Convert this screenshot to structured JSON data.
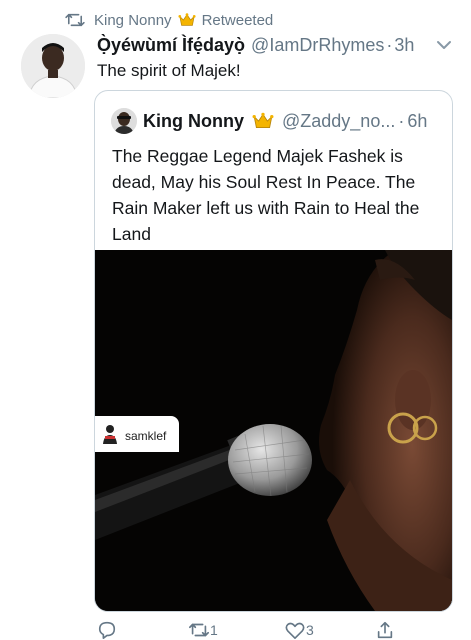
{
  "retweet_bar": {
    "retweeter": "King Nonny",
    "label": "Retweeted"
  },
  "tweet": {
    "author_name": "Ọ̀yéwùmí Ìfẹ́dayọ̀",
    "author_handle": "@IamDrRhymes",
    "separator": "·",
    "time": "3h",
    "text": "The spirit of Majek!"
  },
  "quote": {
    "author_name": "King Nonny",
    "author_handle": "@Zaddy_no...",
    "separator": "·",
    "time": "6h",
    "text": "The Reggae Legend Majek Fashek is dead, May his Soul Rest In Peace. The Rain Maker left us with Rain to Heal the Land",
    "media_watermark": "samklef"
  },
  "actions": {
    "retweet_count": "1",
    "like_count": "3"
  },
  "icons": {
    "retweet": "retweet-icon",
    "crown": "crown-icon",
    "chevron": "chevron-down-icon",
    "reply": "reply-icon",
    "like": "heart-icon",
    "share": "share-icon"
  },
  "colors": {
    "text": "#14171a",
    "muted": "#657786",
    "border": "#ccd6dd",
    "crown": "#f4b400"
  }
}
